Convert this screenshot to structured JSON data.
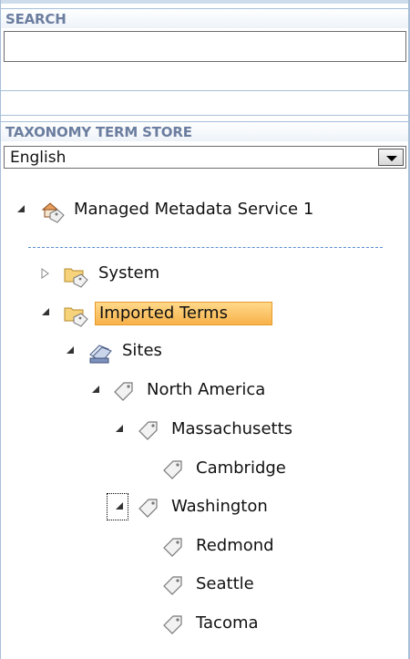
{
  "search": {
    "header": "SEARCH",
    "value": ""
  },
  "taxonomy": {
    "header": "TAXONOMY TERM STORE",
    "language": "English"
  },
  "tree": {
    "root": "Managed Metadata Service 1",
    "system": "System",
    "imported": "Imported Terms",
    "sites": "Sites",
    "north_america": "North America",
    "massachusetts": "Massachusetts",
    "cambridge": "Cambridge",
    "washington": "Washington",
    "redmond": "Redmond",
    "seattle": "Seattle",
    "tacoma": "Tacoma"
  },
  "colors": {
    "header_text": "#6c7ea0",
    "frame": "#a7bfd8",
    "selection": "#f7b24a",
    "dashed": "#5a8fd3"
  }
}
